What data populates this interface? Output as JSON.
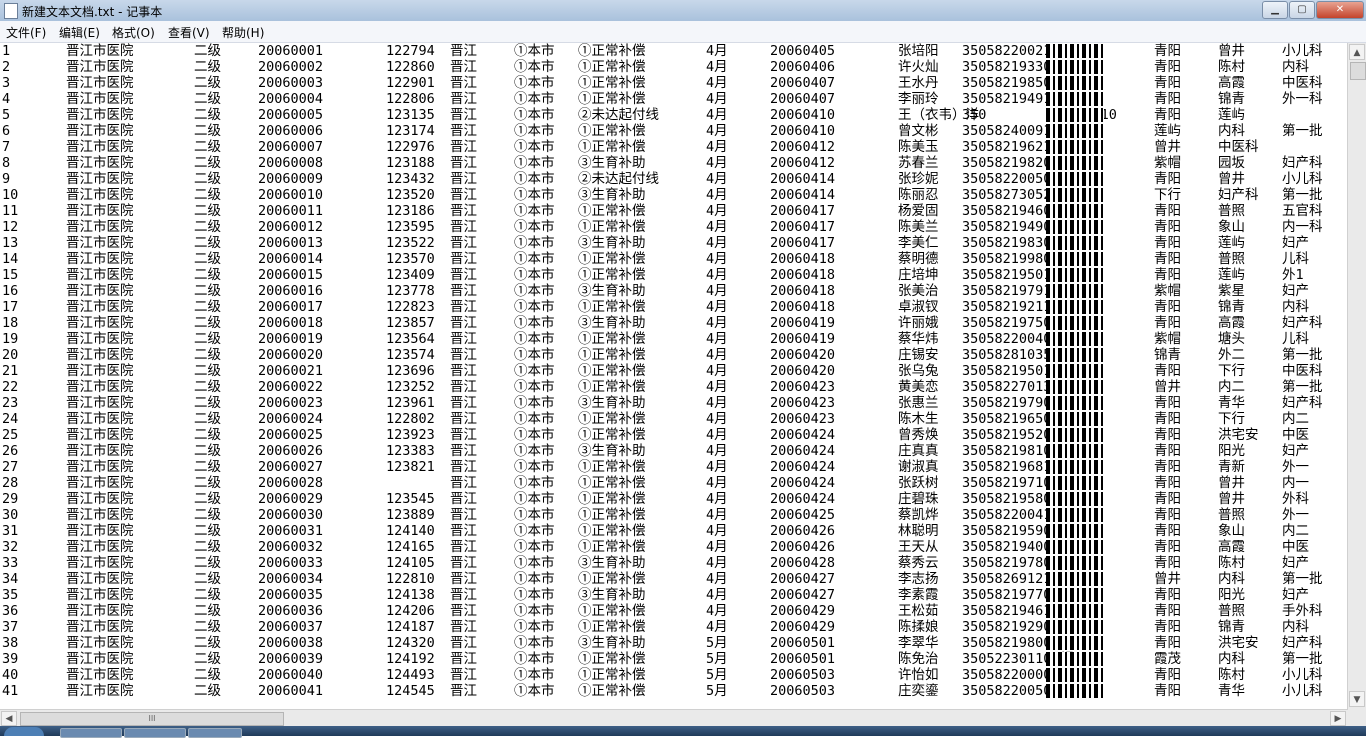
{
  "window": {
    "title": "新建文本文档.txt - 记事本",
    "buttons": {
      "minimize": "▁",
      "maximize": "▢",
      "close": "✕"
    }
  },
  "menu": [
    "文件(F)",
    "编辑(E)",
    "格式(O)",
    "查看(V)",
    "帮助(H)"
  ],
  "rows": [
    [
      "1",
      "晋江市医院",
      "二级",
      "20060001",
      "122794",
      "晋江",
      "①本市",
      "①正常补偿",
      "4月",
      "20060405",
      "张培阳",
      "35058220021",
      "",
      "青阳",
      "曾井",
      "小儿科"
    ],
    [
      "2",
      "晋江市医院",
      "二级",
      "20060002",
      "122860",
      "晋江",
      "①本市",
      "①正常补偿",
      "4月",
      "20060406",
      "许火灿",
      "35058219330",
      "",
      "青阳",
      "陈村",
      "内科"
    ],
    [
      "3",
      "晋江市医院",
      "二级",
      "20060003",
      "122901",
      "晋江",
      "①本市",
      "①正常补偿",
      "4月",
      "20060407",
      "王水丹",
      "35058219850",
      "",
      "青阳",
      "高霞",
      "中医科"
    ],
    [
      "4",
      "晋江市医院",
      "二级",
      "20060004",
      "122806",
      "晋江",
      "①本市",
      "①正常补偿",
      "4月",
      "20060407",
      "李丽玲",
      "35058219491",
      "",
      "青阳",
      "锦青",
      "外一科"
    ],
    [
      "5",
      "晋江市医院",
      "二级",
      "20060005",
      "123135",
      "晋江",
      "①本市",
      "②未达起付线",
      "4月",
      "20060410",
      "王（衣韦）洋",
      "350",
      "5050010",
      "青阳",
      "莲屿",
      ""
    ],
    [
      "6",
      "晋江市医院",
      "二级",
      "20060006",
      "123174",
      "晋江",
      "①本市",
      "①正常补偿",
      "4月",
      "20060410",
      "曾文彬",
      "35058240091",
      "阳",
      "莲屿",
      "内科",
      "第一批"
    ],
    [
      "7",
      "晋江市医院",
      "二级",
      "20060007",
      "122976",
      "晋江",
      "①本市",
      "①正常补偿",
      "4月",
      "20060412",
      "陈美玉",
      "35058219621",
      "",
      "曾井",
      "中医科",
      ""
    ],
    [
      "8",
      "晋江市医院",
      "二级",
      "20060008",
      "123188",
      "晋江",
      "①本市",
      "③生育补助",
      "4月",
      "20060412",
      "苏春兰",
      "35058219820",
      "",
      "紫帽",
      "园坂",
      "妇产科"
    ],
    [
      "9",
      "晋江市医院",
      "二级",
      "20060009",
      "123432",
      "晋江",
      "①本市",
      "②未达起付线",
      "4月",
      "20060414",
      "张珍妮",
      "35058220050",
      "",
      "青阳",
      "曾井",
      "小儿科"
    ],
    [
      "10",
      "晋江市医院",
      "二级",
      "20060010",
      "123520",
      "晋江",
      "①本市",
      "③生育补助",
      "4月",
      "20060414",
      "陈丽忍",
      "35058273052",
      "阳",
      "下行",
      "妇产科",
      "第一批"
    ],
    [
      "11",
      "晋江市医院",
      "二级",
      "20060011",
      "123186",
      "晋江",
      "①本市",
      "①正常补偿",
      "4月",
      "20060417",
      "杨爱固",
      "35058219460",
      "",
      "青阳",
      "普照",
      "五官科"
    ],
    [
      "12",
      "晋江市医院",
      "二级",
      "20060012",
      "123595",
      "晋江",
      "①本市",
      "①正常补偿",
      "4月",
      "20060417",
      "陈美兰",
      "35058219490",
      "",
      "青阳",
      "象山",
      "内一科"
    ],
    [
      "13",
      "晋江市医院",
      "二级",
      "20060013",
      "123522",
      "晋江",
      "①本市",
      "③生育补助",
      "4月",
      "20060417",
      "李美仁",
      "35058219830",
      "",
      "青阳",
      "莲屿",
      "妇产"
    ],
    [
      "14",
      "晋江市医院",
      "二级",
      "20060014",
      "123570",
      "晋江",
      "①本市",
      "①正常补偿",
      "4月",
      "20060418",
      "蔡明德",
      "35058219980",
      "",
      "青阳",
      "普照",
      "儿科"
    ],
    [
      "15",
      "晋江市医院",
      "二级",
      "20060015",
      "123409",
      "晋江",
      "①本市",
      "①正常补偿",
      "4月",
      "20060418",
      "庄培坤",
      "35058219501",
      "",
      "青阳",
      "莲屿",
      "外1"
    ],
    [
      "16",
      "晋江市医院",
      "二级",
      "20060016",
      "123778",
      "晋江",
      "①本市",
      "③生育补助",
      "4月",
      "20060418",
      "张美治",
      "35058219791",
      "",
      "紫帽",
      "紫星",
      "妇产"
    ],
    [
      "17",
      "晋江市医院",
      "二级",
      "20060017",
      "122823",
      "晋江",
      "①本市",
      "①正常补偿",
      "4月",
      "20060418",
      "卓淑钗",
      "35058219211",
      "",
      "青阳",
      "锦青",
      "内科"
    ],
    [
      "18",
      "晋江市医院",
      "二级",
      "20060018",
      "123857",
      "晋江",
      "①本市",
      "③生育补助",
      "4月",
      "20060419",
      "许丽娥",
      "35058219750",
      "",
      "青阳",
      "高霞",
      "妇产科"
    ],
    [
      "19",
      "晋江市医院",
      "二级",
      "20060019",
      "123564",
      "晋江",
      "①本市",
      "①正常补偿",
      "4月",
      "20060419",
      "蔡华炜",
      "35058220040",
      "",
      "紫帽",
      "塘头",
      "儿科"
    ],
    [
      "20",
      "晋江市医院",
      "二级",
      "20060020",
      "123574",
      "晋江",
      "①本市",
      "①正常补偿",
      "4月",
      "20060420",
      "庄锡安",
      "35058281035",
      "阳",
      "锦青",
      "外二",
      "第一批"
    ],
    [
      "21",
      "晋江市医院",
      "二级",
      "20060021",
      "123696",
      "晋江",
      "①本市",
      "①正常补偿",
      "4月",
      "20060420",
      "张乌兔",
      "35058219501",
      "",
      "青阳",
      "下行",
      "中医科"
    ],
    [
      "22",
      "晋江市医院",
      "二级",
      "20060022",
      "123252",
      "晋江",
      "①本市",
      "①正常补偿",
      "4月",
      "20060423",
      "黄美恋",
      "35058227013",
      "阳",
      "曾井",
      "内二",
      "第一批"
    ],
    [
      "23",
      "晋江市医院",
      "二级",
      "20060023",
      "123961",
      "晋江",
      "①本市",
      "③生育补助",
      "4月",
      "20060423",
      "张惠兰",
      "35058219790",
      "",
      "青阳",
      "青华",
      "妇产科"
    ],
    [
      "24",
      "晋江市医院",
      "二级",
      "20060024",
      "122802",
      "晋江",
      "①本市",
      "①正常补偿",
      "4月",
      "20060423",
      "陈木生",
      "35058219650",
      "",
      "青阳",
      "下行",
      "内二"
    ],
    [
      "25",
      "晋江市医院",
      "二级",
      "20060025",
      "123923",
      "晋江",
      "①本市",
      "①正常补偿",
      "4月",
      "20060424",
      "曾秀焕",
      "35058219520",
      "",
      "青阳",
      "洪宅安",
      "中医"
    ],
    [
      "26",
      "晋江市医院",
      "二级",
      "20060026",
      "123383",
      "晋江",
      "①本市",
      "③生育补助",
      "4月",
      "20060424",
      "庄真真",
      "35058219810",
      "",
      "青阳",
      "阳光",
      "妇产"
    ],
    [
      "27",
      "晋江市医院",
      "二级",
      "20060027",
      "123821",
      "晋江",
      "①本市",
      "①正常补偿",
      "4月",
      "20060424",
      "谢淑真",
      "35058219681",
      "",
      "青阳",
      "青新",
      "外一"
    ],
    [
      "28",
      "晋江市医院",
      "二级",
      "20060028",
      "",
      "晋江",
      "①本市",
      "①正常补偿",
      "4月",
      "20060424",
      "张跃树",
      "35058219710",
      "",
      "青阳",
      "曾井",
      "内一"
    ],
    [
      "29",
      "晋江市医院",
      "二级",
      "20060029",
      "123545",
      "晋江",
      "①本市",
      "①正常补偿",
      "4月",
      "20060424",
      "庄碧珠",
      "35058219580",
      "",
      "青阳",
      "曾井",
      "外科"
    ],
    [
      "30",
      "晋江市医院",
      "二级",
      "20060030",
      "123889",
      "晋江",
      "①本市",
      "①正常补偿",
      "4月",
      "20060425",
      "蔡凯烨",
      "35058220041",
      "",
      "青阳",
      "普照",
      "外一"
    ],
    [
      "31",
      "晋江市医院",
      "二级",
      "20060031",
      "124140",
      "晋江",
      "①本市",
      "①正常补偿",
      "4月",
      "20060426",
      "林聪明",
      "35058219590",
      "",
      "青阳",
      "象山",
      "内二"
    ],
    [
      "32",
      "晋江市医院",
      "二级",
      "20060032",
      "124165",
      "晋江",
      "①本市",
      "①正常补偿",
      "4月",
      "20060426",
      "王天从",
      "35058219400",
      "",
      "青阳",
      "高霞",
      "中医"
    ],
    [
      "33",
      "晋江市医院",
      "二级",
      "20060033",
      "124105",
      "晋江",
      "①本市",
      "③生育补助",
      "4月",
      "20060428",
      "蔡秀云",
      "35058219780",
      "",
      "青阳",
      "陈村",
      "妇产"
    ],
    [
      "34",
      "晋江市医院",
      "二级",
      "20060034",
      "122810",
      "晋江",
      "①本市",
      "①正常补偿",
      "4月",
      "20060427",
      "李志扬",
      "35058269121",
      "阳",
      "曾井",
      "内科",
      "第一批"
    ],
    [
      "35",
      "晋江市医院",
      "二级",
      "20060035",
      "124138",
      "晋江",
      "①本市",
      "③生育补助",
      "4月",
      "20060427",
      "李素霞",
      "35058219770",
      "",
      "青阳",
      "阳光",
      "妇产"
    ],
    [
      "36",
      "晋江市医院",
      "二级",
      "20060036",
      "124206",
      "晋江",
      "①本市",
      "①正常补偿",
      "4月",
      "20060429",
      "王松茹",
      "35058219461",
      "",
      "青阳",
      "普照",
      "手外科"
    ],
    [
      "37",
      "晋江市医院",
      "二级",
      "20060037",
      "124187",
      "晋江",
      "①本市",
      "①正常补偿",
      "4月",
      "20060429",
      "陈揉娘",
      "35058219290",
      "",
      "青阳",
      "锦青",
      "内科"
    ],
    [
      "38",
      "晋江市医院",
      "二级",
      "20060038",
      "124320",
      "晋江",
      "①本市",
      "③生育补助",
      "5月",
      "20060501",
      "李翠华",
      "35058219800",
      "",
      "青阳",
      "洪宅安",
      "妇产科"
    ],
    [
      "39",
      "晋江市医院",
      "二级",
      "20060039",
      "124192",
      "晋江",
      "①本市",
      "①正常补偿",
      "5月",
      "20060501",
      "陈免治",
      "35052230110",
      "帽",
      "霞茂",
      "内科",
      "第一批"
    ],
    [
      "40",
      "晋江市医院",
      "二级",
      "20060040",
      "124493",
      "晋江",
      "①本市",
      "①正常补偿",
      "5月",
      "20060503",
      "许怡如",
      "35058220000",
      "",
      "青阳",
      "陈村",
      "小儿科"
    ],
    [
      "41",
      "晋江市医院",
      "二级",
      "20060041",
      "124545",
      "晋江",
      "①本市",
      "①正常补偿",
      "5月",
      "20060503",
      "庄奕鎏",
      "35058220050",
      "",
      "青阳",
      "青华",
      "小儿科"
    ]
  ],
  "scrollbar": {
    "up": "▲",
    "down": "▼",
    "left": "◀",
    "right": "▶",
    "grip": "III"
  }
}
